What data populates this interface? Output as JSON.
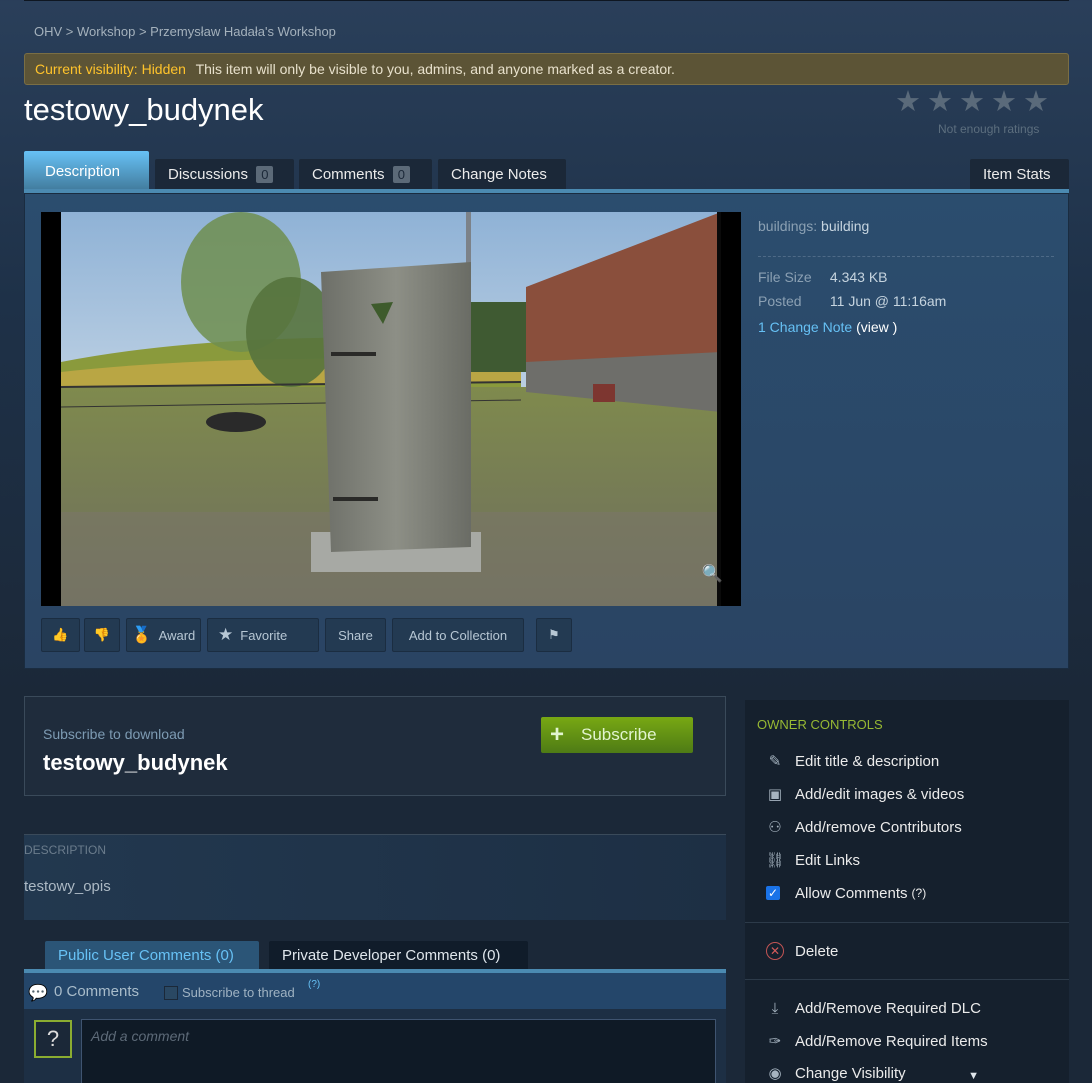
{
  "breadcrumb": {
    "app": "OHV",
    "sep1": ">",
    "workshop": "Workshop",
    "sep2": ">",
    "owner_workshop": "Przemysław Hadała's Workshop"
  },
  "visibility": {
    "label": "Current visibility: Hidden",
    "message": "This item will only be visible to you, admins, and anyone marked as a creator."
  },
  "item": {
    "title": "testowy_budynek",
    "ratings_text": "Not enough ratings",
    "rating_stars": 0
  },
  "tabs": {
    "description": "Description",
    "discussions": "Discussions",
    "discussions_count": "0",
    "comments": "Comments",
    "comments_count": "0",
    "change_notes": "Change Notes",
    "item_stats": "Item Stats"
  },
  "meta": {
    "tag_key": "buildings:",
    "tag_value": "building",
    "file_size_label": "File Size",
    "file_size": "4.343 KB",
    "posted_label": "Posted",
    "posted": "11 Jun @ 11:16am",
    "change_note_link": "1 Change Note",
    "view_open": "(",
    "view_link": "view",
    "view_close": ")"
  },
  "actions": {
    "award": "Award",
    "favorite": "Favorite",
    "share": "Share",
    "add_to_collection": "Add to Collection"
  },
  "subscribe": {
    "label": "Subscribe to download",
    "name": "testowy_budynek",
    "button": "Subscribe",
    "plus": "+"
  },
  "description": {
    "title": "DESCRIPTION",
    "text": "testowy_opis"
  },
  "comments": {
    "public_tab": "Public User Comments (0)",
    "private_tab": "Private Developer Comments (0)",
    "count_text": "0 Comments",
    "subscribe_thread": "Subscribe to thread",
    "help": "(?)",
    "avatar_placeholder": "?",
    "placeholder": "Add a comment"
  },
  "owner_controls": {
    "title": "OWNER CONTROLS",
    "edit_title": "Edit title & description",
    "edit_images": "Add/edit images & videos",
    "contributors": "Add/remove Contributors",
    "edit_links": "Edit Links",
    "allow_comments": "Allow Comments",
    "allow_comments_help": "(?)",
    "delete": "Delete",
    "required_dlc": "Add/Remove Required DLC",
    "required_items": "Add/Remove Required Items",
    "change_visibility": "Change Visibility"
  },
  "colors": {
    "accent_blue": "#67c1f5",
    "subscribe_green": "#78a813",
    "owner_green": "#97b833",
    "hidden_label": "#ffc32b"
  }
}
